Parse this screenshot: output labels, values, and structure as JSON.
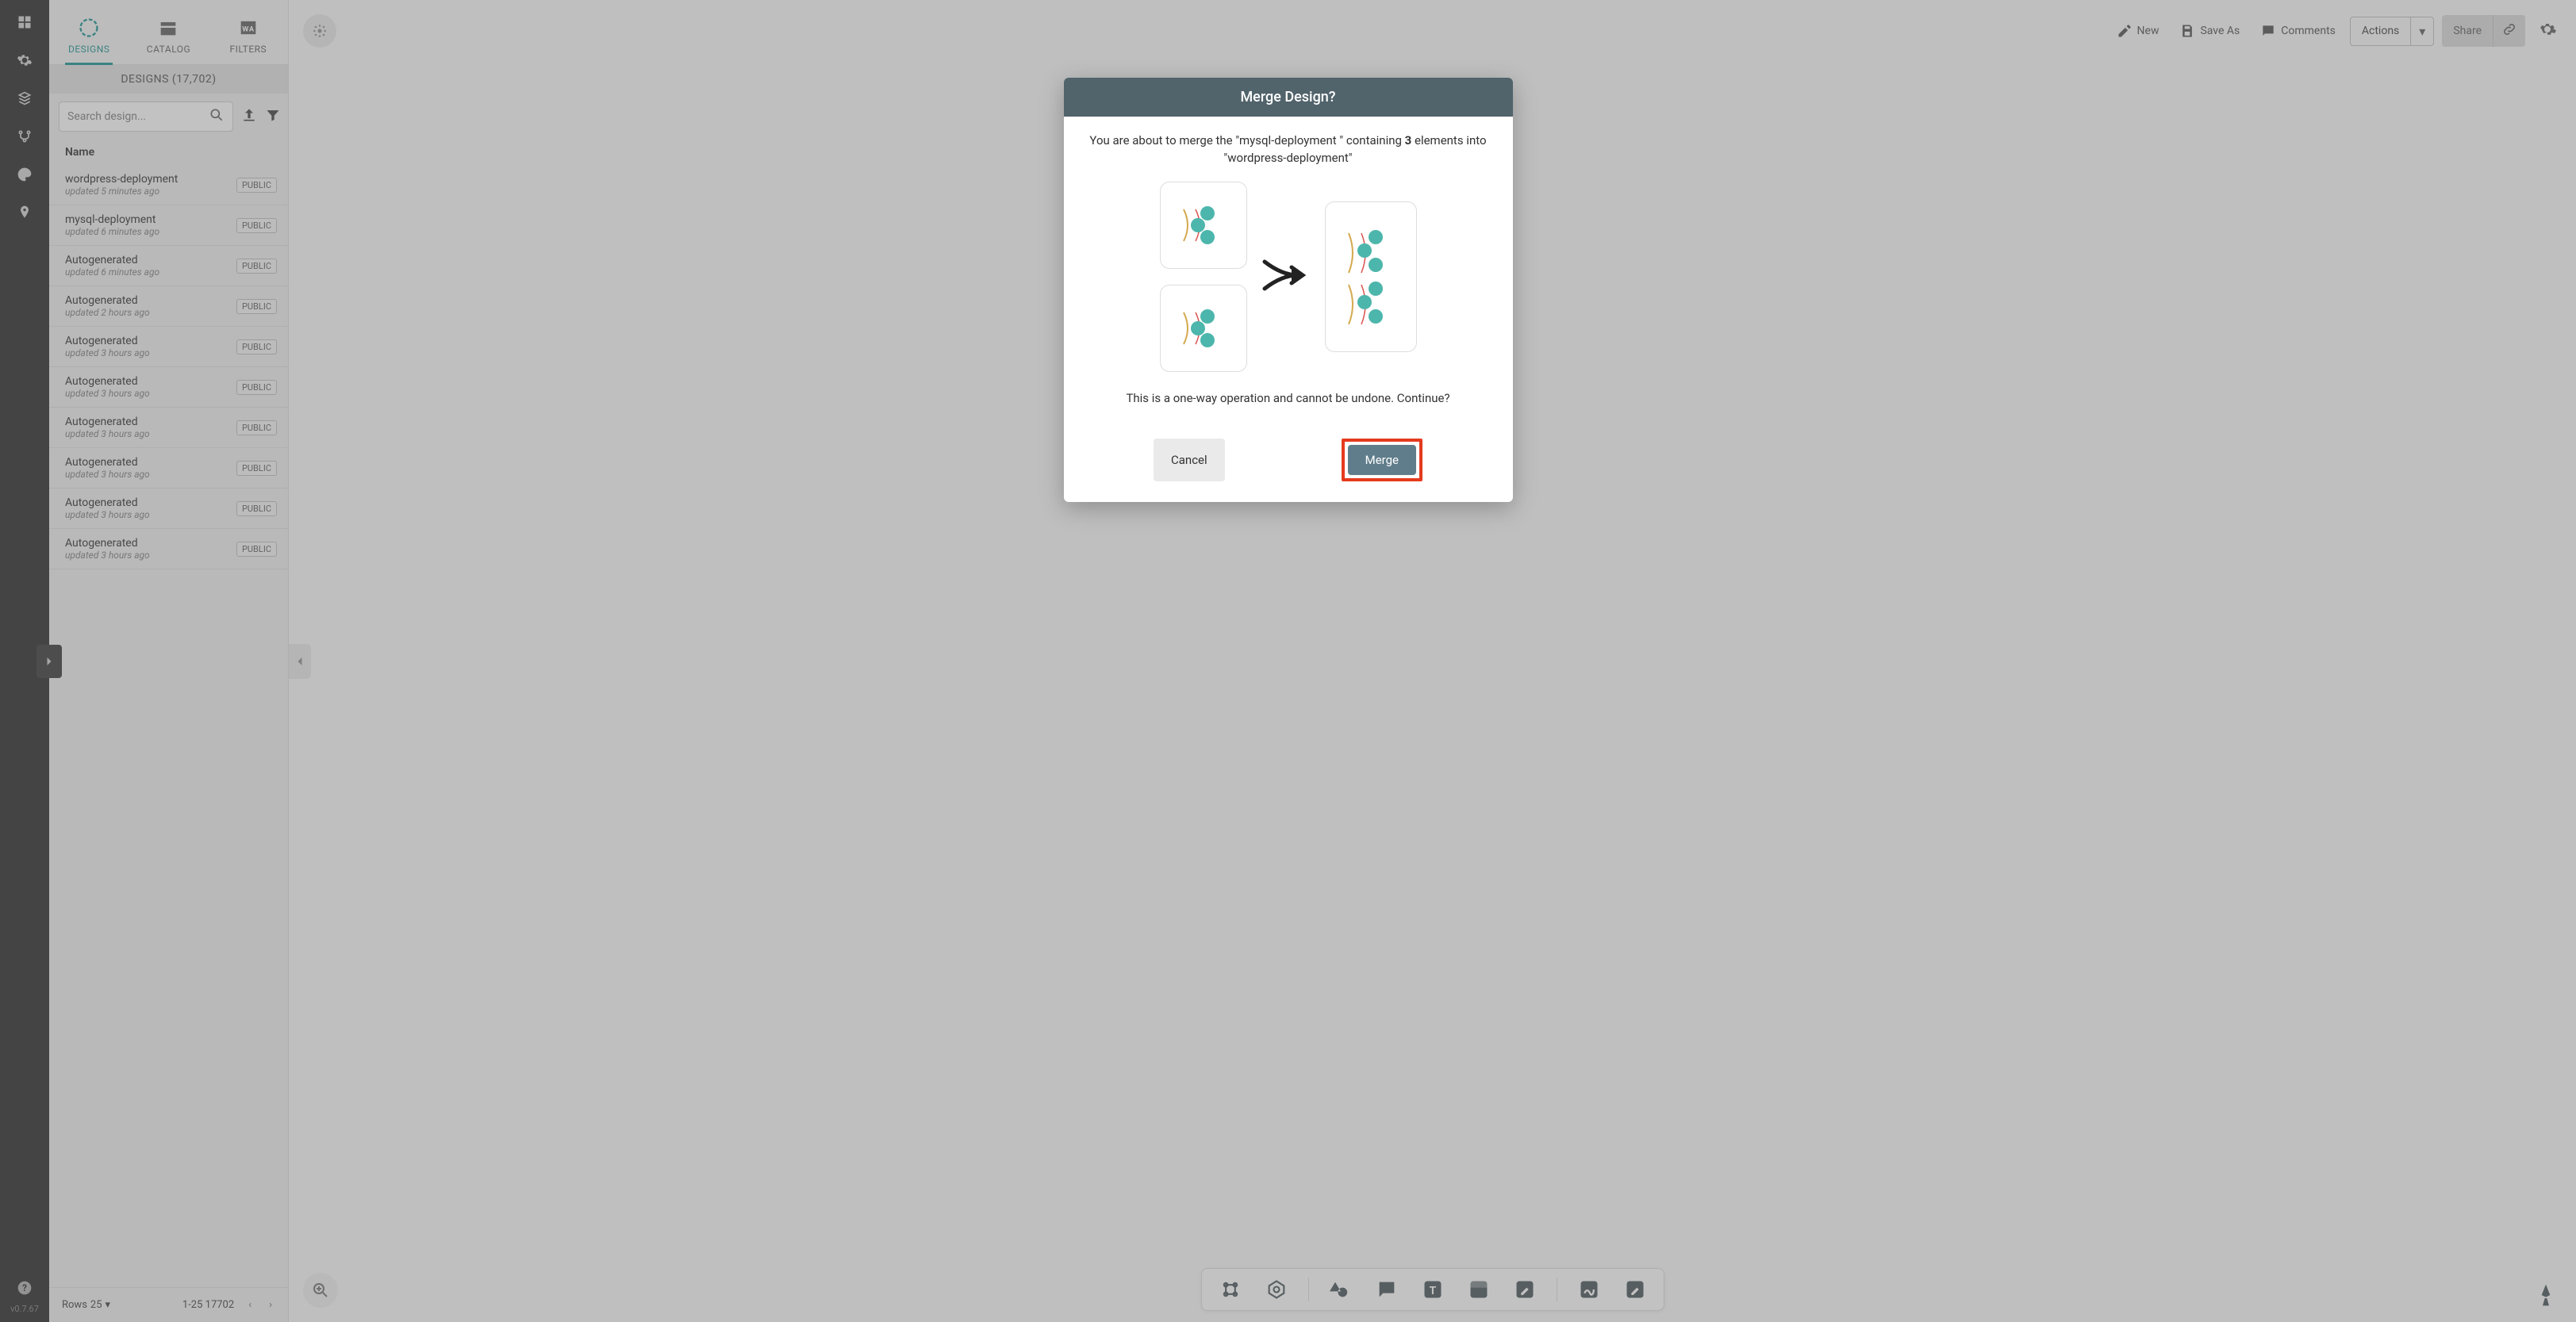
{
  "rail": {
    "version": "v0.7.67"
  },
  "panel": {
    "tabs": {
      "designs": "DESIGNS",
      "catalog": "CATALOG",
      "filters": "FILTERS"
    },
    "header": "DESIGNS (17,702)",
    "search_placeholder": "Search design...",
    "list_header": "Name",
    "items": [
      {
        "name": "wordpress-deployment",
        "time": "updated 5 minutes ago",
        "badge": "PUBLIC"
      },
      {
        "name": "mysql-deployment",
        "time": "updated 6 minutes ago",
        "badge": "PUBLIC"
      },
      {
        "name": "Autogenerated",
        "time": "updated 6 minutes ago",
        "badge": "PUBLIC"
      },
      {
        "name": "Autogenerated",
        "time": "updated 2 hours ago",
        "badge": "PUBLIC"
      },
      {
        "name": "Autogenerated",
        "time": "updated 3 hours ago",
        "badge": "PUBLIC"
      },
      {
        "name": "Autogenerated",
        "time": "updated 3 hours ago",
        "badge": "PUBLIC"
      },
      {
        "name": "Autogenerated",
        "time": "updated 3 hours ago",
        "badge": "PUBLIC"
      },
      {
        "name": "Autogenerated",
        "time": "updated 3 hours ago",
        "badge": "PUBLIC"
      },
      {
        "name": "Autogenerated",
        "time": "updated 3 hours ago",
        "badge": "PUBLIC"
      },
      {
        "name": "Autogenerated",
        "time": "updated 3 hours ago",
        "badge": "PUBLIC"
      }
    ],
    "pager": {
      "rows_label": "Rows",
      "rows_value": "25",
      "range": "1-25 17702"
    }
  },
  "topbar": {
    "new": "New",
    "save_as": "Save As",
    "comments": "Comments",
    "actions": "Actions",
    "share": "Share"
  },
  "modal": {
    "title": "Merge Design?",
    "msg_pre": "You are about to merge the \"mysql-deployment \" containing ",
    "msg_count": "3",
    "msg_post": " elements into \"wordpress-deployment\"",
    "warn": "This is a one-way operation and cannot be undone. Continue?",
    "cancel": "Cancel",
    "merge": "Merge"
  }
}
